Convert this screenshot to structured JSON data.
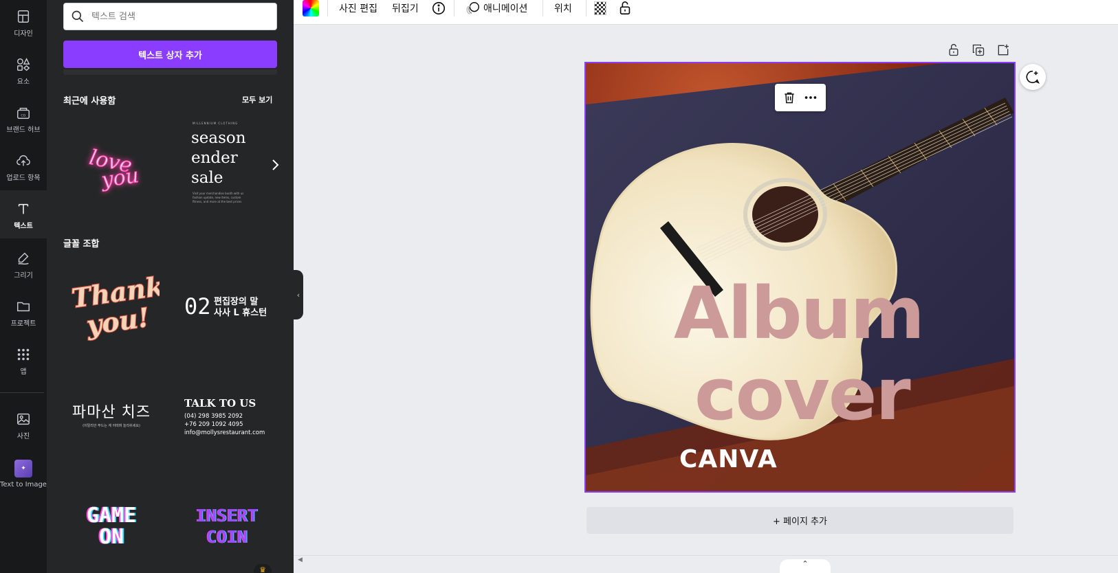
{
  "rail": {
    "items": [
      {
        "label": "디자인"
      },
      {
        "label": "요소"
      },
      {
        "label": "브랜드 허브"
      },
      {
        "label": "업로드 항목"
      },
      {
        "label": "텍스트"
      },
      {
        "label": "그리기"
      },
      {
        "label": "프로젝트"
      },
      {
        "label": "앱"
      },
      {
        "label": "사진"
      },
      {
        "label": "Text to Image"
      }
    ]
  },
  "panel": {
    "search_placeholder": "텍스트 검색",
    "add_textbox_label": "텍스트 상자 추가",
    "recent_title": "최근에 사용함",
    "see_all_label": "모두 보기",
    "recent_items": [
      {
        "line1": "love",
        "line2": "you"
      },
      {
        "kicker": "MILLENNIUM CLOTHING",
        "lines": [
          "season",
          "ender",
          "sale"
        ],
        "fine": [
          "Visit your merchandise booth with us",
          "fashion update, new items, custom",
          "fitness, and more at the best prices"
        ]
      }
    ],
    "font_combo_title": "글꼴 조합",
    "combos": [
      {
        "line1": "Thank",
        "line2": "you!"
      },
      {
        "number": "02",
        "line1": "편집장의 말",
        "line2": "사사 L 휴스턴"
      },
      {
        "title": "파마산 치즈",
        "sub": "(이탈리안 푸드는 계 어떠며 늘리쉬세요)"
      },
      {
        "title": "TALK TO US",
        "phone1": "(04) 298 3985 2092",
        "phone2": "+76 209 1092 4095",
        "email": "info@mollysrestaurant.com"
      },
      {
        "line1": "GAME",
        "line2": "ON"
      },
      {
        "line1": "INSERT",
        "line2": "COIN"
      }
    ]
  },
  "toolbar": {
    "edit_photo": "사진 편집",
    "flip": "뒤집기",
    "animate": "애니메이션",
    "position": "위치"
  },
  "design": {
    "title_line1": "Album",
    "title_line2": "cover",
    "brand": "CANVA",
    "title_color": "#cc9b99"
  },
  "add_page_label": "+ 페이지 추가",
  "colors": {
    "accent": "#8b3dff",
    "rail_bg": "#18191b",
    "panel_bg": "#252627",
    "canvas_bg": "#ebecf0"
  }
}
